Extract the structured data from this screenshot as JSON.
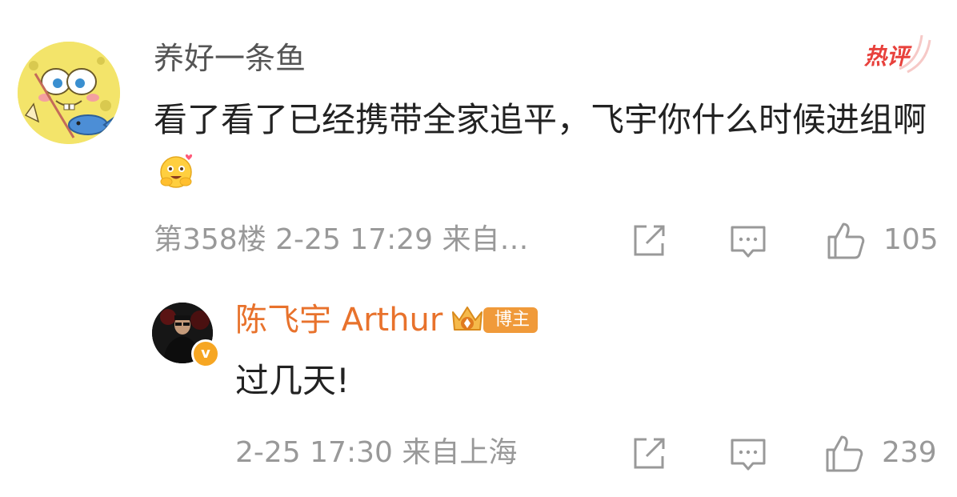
{
  "comment1": {
    "username": "养好一条鱼",
    "hot_label": "热评",
    "text": "看了看了已经携带全家追平，飞宇你什么时候进组啊",
    "meta": "第358楼  2-25 17:29  来自…",
    "like_count": "105",
    "avatar_icon": "spongebob-avatar-icon"
  },
  "reply": {
    "username": "陈飞宇 Arthur",
    "verified_mark": "v",
    "role_badge": "博主",
    "text": "过几天!",
    "meta": "2-25 17:30  来自上海",
    "like_count": "239",
    "avatar_icon": "person-avatar-icon"
  },
  "colors": {
    "username_gray": "#555555",
    "reply_name_orange": "#e8722c",
    "hot_red": "#e8413c",
    "meta_gray": "#999999"
  }
}
